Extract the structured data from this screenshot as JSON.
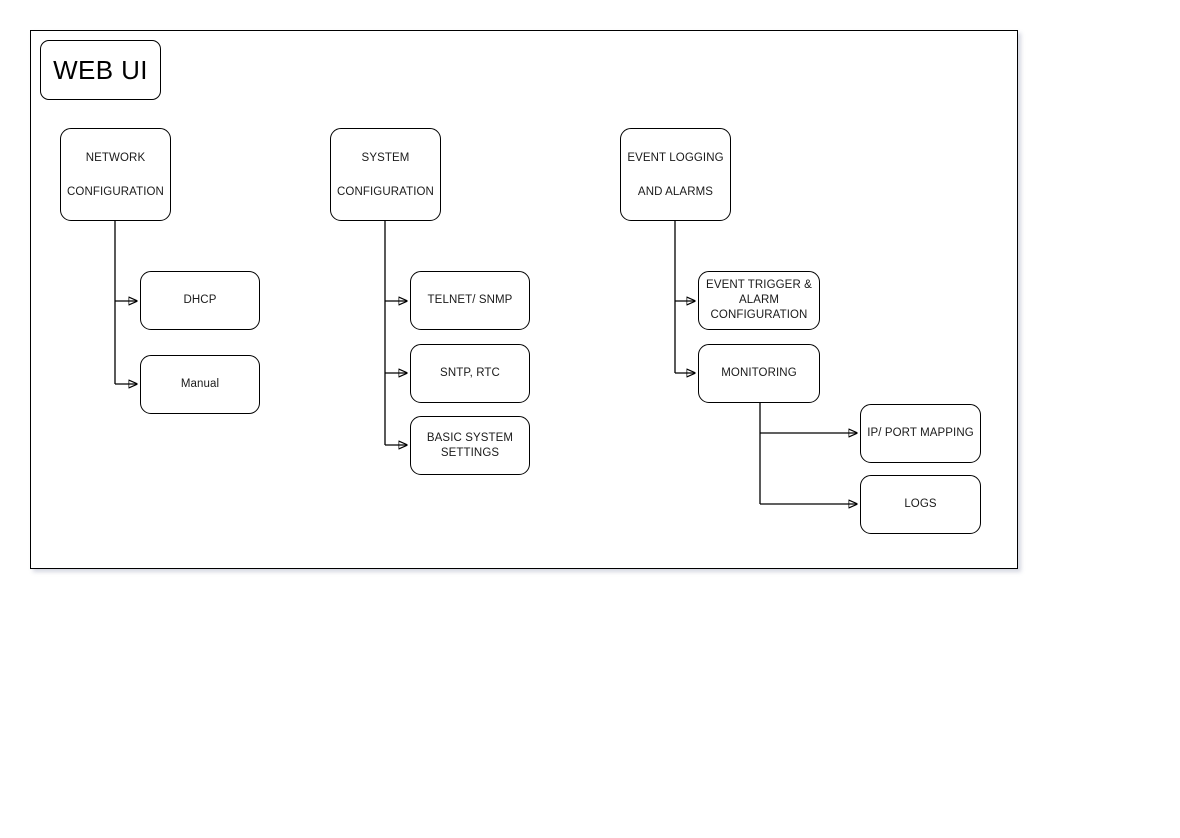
{
  "diagram": {
    "title_node": {
      "label": "WEB UI"
    },
    "sections": [
      {
        "id": "network-configuration",
        "label": "NETWORK\nCONFIGURATION"
      },
      {
        "id": "system-configuration",
        "label": "SYSTEM\nCONFIGURATION"
      },
      {
        "id": "event-logging-and-alarms",
        "label": "EVENT LOGGING\nAND ALARMS"
      }
    ],
    "network_children": [
      {
        "id": "dhcp",
        "label": "DHCP"
      },
      {
        "id": "manual",
        "label": "Manual"
      }
    ],
    "system_children": [
      {
        "id": "telnet-snmp",
        "label": "TELNET/ SNMP"
      },
      {
        "id": "sntp-rtc",
        "label": "SNTP, RTC"
      },
      {
        "id": "basic-system-settings",
        "label": "BASIC SYSTEM\nSETTINGS"
      }
    ],
    "event_children": [
      {
        "id": "event-trigger-alarm-configuration",
        "label": "EVENT TRIGGER &\nALARM\nCONFIGURATION"
      },
      {
        "id": "monitoring",
        "label": "MONITORING"
      }
    ],
    "monitoring_children": [
      {
        "id": "ip-port-mapping",
        "label": "IP/ PORT MAPPING"
      },
      {
        "id": "logs",
        "label": "LOGS"
      }
    ],
    "colors": {
      "stroke": "#000000",
      "background": "#ffffff",
      "text": "#1a1a1a"
    }
  }
}
